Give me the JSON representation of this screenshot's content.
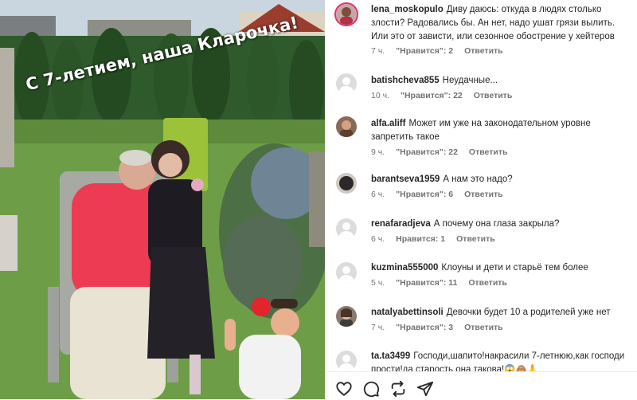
{
  "post": {
    "caption": "С 7-летием, наша Кларочка!"
  },
  "comments": [
    {
      "username": "lena_moskopulo",
      "text": "Диву даюсь: откуда в людях столько злости? Радовались бы. Ан нет, надо ушат грязи вылить. Или это от зависти, или сезонное обострение у хейтеров",
      "time": "7 ч.",
      "likes": "\"Нравится\": 2",
      "reply": "Ответить",
      "avatar": "photo-pink"
    },
    {
      "username": "batishcheva855",
      "text": "Неудачные...",
      "time": "10 ч.",
      "likes": "\"Нравится\": 22",
      "reply": "Ответить",
      "avatar": "default"
    },
    {
      "username": "alfa.aliff",
      "text": "Может им уже на законодательном уровне запретить такое",
      "time": "9 ч.",
      "likes": "\"Нравится\": 22",
      "reply": "Ответить",
      "avatar": "photo-brown"
    },
    {
      "username": "barantseva1959",
      "text": "А нам это надо?",
      "time": "6 ч.",
      "likes": "\"Нравится\": 6",
      "reply": "Ответить",
      "avatar": "photo-dark"
    },
    {
      "username": "renafaradjeva",
      "text": "А почему она глаза закрыла?",
      "time": "6 ч.",
      "likes": "Нравится: 1",
      "reply": "Ответить",
      "avatar": "default"
    },
    {
      "username": "kuzmina555000",
      "text": "Клоуны и дети и старьё тем более",
      "time": "5 ч.",
      "likes": "\"Нравится\": 11",
      "reply": "Ответить",
      "avatar": "default"
    },
    {
      "username": "natalyabettinsoli",
      "text": "Девочки будет 10 а родителей уже нет",
      "time": "7 ч.",
      "likes": "\"Нравится\": 3",
      "reply": "Ответить",
      "avatar": "photo-woman"
    },
    {
      "username": "ta.ta3499",
      "text": "Господи,шапито!накрасили 7-летнюю,как господи прости!да старость она такова!😱🙈🙏",
      "time": "",
      "likes": "",
      "reply": "",
      "avatar": "default"
    }
  ],
  "actions": {
    "icons": [
      "heart-icon",
      "comment-icon",
      "repost-icon",
      "share-icon"
    ]
  }
}
